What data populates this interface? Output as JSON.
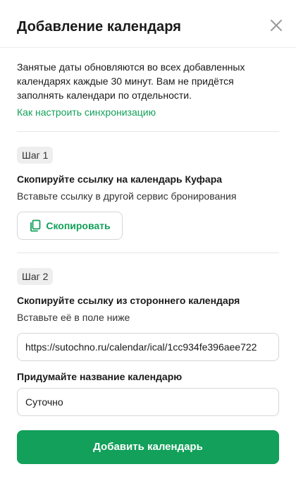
{
  "dialog": {
    "title": "Добавление календаря",
    "close_icon": "close-icon"
  },
  "info": {
    "text": "Занятые даты обновляются во всех добавленных календарях каждые 30 минут. Вам не придётся заполнять календари по отдельности.",
    "link": "Как настроить синхронизацию"
  },
  "step1": {
    "badge": "Шаг 1",
    "title": "Скопируйте ссылку на календарь Куфара",
    "subtitle": "Вставьте ссылку в другой сервис бронирования",
    "copy_button": "Скопировать",
    "copy_icon": "copy-icon"
  },
  "step2": {
    "badge": "Шаг 2",
    "title": "Скопируйте ссылку из стороннего календаря",
    "subtitle": "Вставьте её в поле ниже",
    "url_value": "https://sutochno.ru/calendar/ical/1cc934fe396aee722",
    "name_label": "Придумайте название календарю",
    "name_value": "Суточно"
  },
  "submit": {
    "label": "Добавить календарь"
  },
  "colors": {
    "accent": "#12a05a",
    "text": "#1a1a1a",
    "badge_bg": "#eeeeee",
    "border": "#d6d6d6"
  }
}
